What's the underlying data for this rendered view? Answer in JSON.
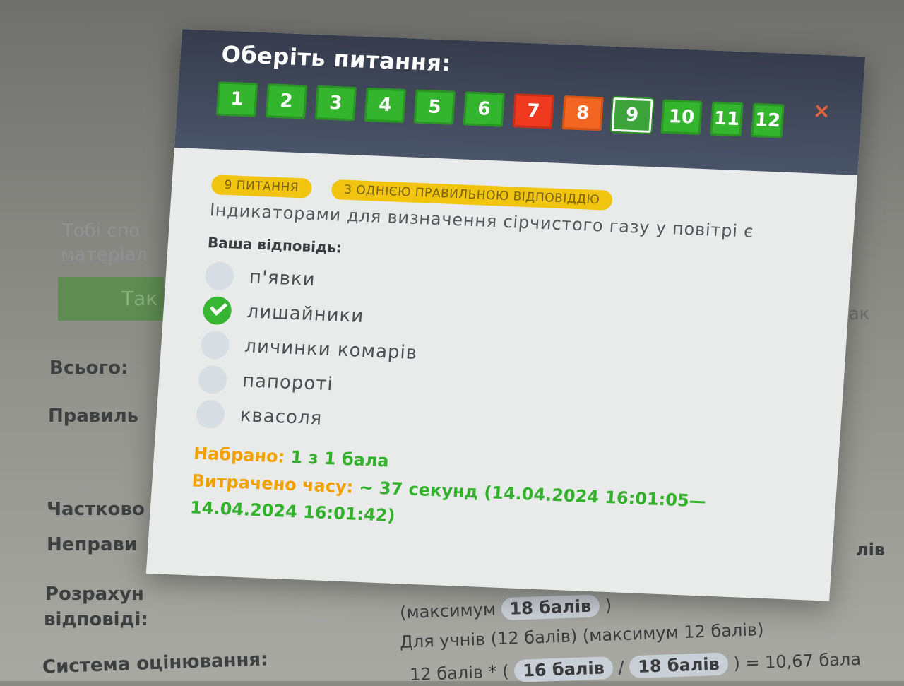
{
  "modal": {
    "title": "Оберіть питання:",
    "close_symbol": "×",
    "questions": [
      {
        "num": "1",
        "status": "correct"
      },
      {
        "num": "2",
        "status": "correct"
      },
      {
        "num": "3",
        "status": "correct"
      },
      {
        "num": "4",
        "status": "correct"
      },
      {
        "num": "5",
        "status": "correct"
      },
      {
        "num": "6",
        "status": "correct"
      },
      {
        "num": "7",
        "status": "wrong"
      },
      {
        "num": "8",
        "status": "partial"
      },
      {
        "num": "9",
        "status": "current"
      },
      {
        "num": "10",
        "status": "correct"
      },
      {
        "num": "11",
        "status": "correct"
      },
      {
        "num": "12",
        "status": "correct"
      }
    ],
    "tag_number": "9 ПИТАННЯ",
    "tag_type": "З ОДНІЄЮ ПРАВИЛЬНОЮ ВІДПОВІДДЮ",
    "question_text": "Індикаторами для визначення сірчистого газу у повітрі є",
    "answer_label": "Ваша відповідь:",
    "options": [
      {
        "text": "п'явки",
        "checked": false
      },
      {
        "text": "лишайники",
        "checked": true
      },
      {
        "text": "личинки комарів",
        "checked": false
      },
      {
        "text": "папороті",
        "checked": false
      },
      {
        "text": "квасоля",
        "checked": false
      }
    ],
    "score_label": "Набрано:",
    "score_value": "1 з 1 бала",
    "time_label": "Витрачено часу:",
    "time_value": "~ 37 секунд (14.04.2024 16:01:05—",
    "time_value_2": "14.04.2024 16:01:42)"
  },
  "background": {
    "faint_1": "Тобі спо",
    "faint_2": "матеріал",
    "button_fragment": "Так",
    "total": "Всього:",
    "correct": "Правиль",
    "partial": "Частково",
    "wrong": "Неправи",
    "calc_1": "Розрахун",
    "calc_2": "відповіді:",
    "system": "Система оцінювання:",
    "max_prefix": "(максимум",
    "max_value": "18 балів",
    "max_suffix": ")",
    "students_line": "Для учнів (12 балів) (максимум 12 балів)",
    "formula_prefix": "12 балів * (",
    "formula_a": "16 балів",
    "formula_sep": "/",
    "formula_b": "18 балів",
    "formula_result": ") = 10,67 бала",
    "right_fragment": "лів",
    "right_fragment_2": "ак"
  },
  "colors": {
    "correct": "#34b52e",
    "wrong": "#f03a20",
    "partial": "#f26522",
    "tag": "#f1c40f",
    "header": "#3d4456"
  }
}
